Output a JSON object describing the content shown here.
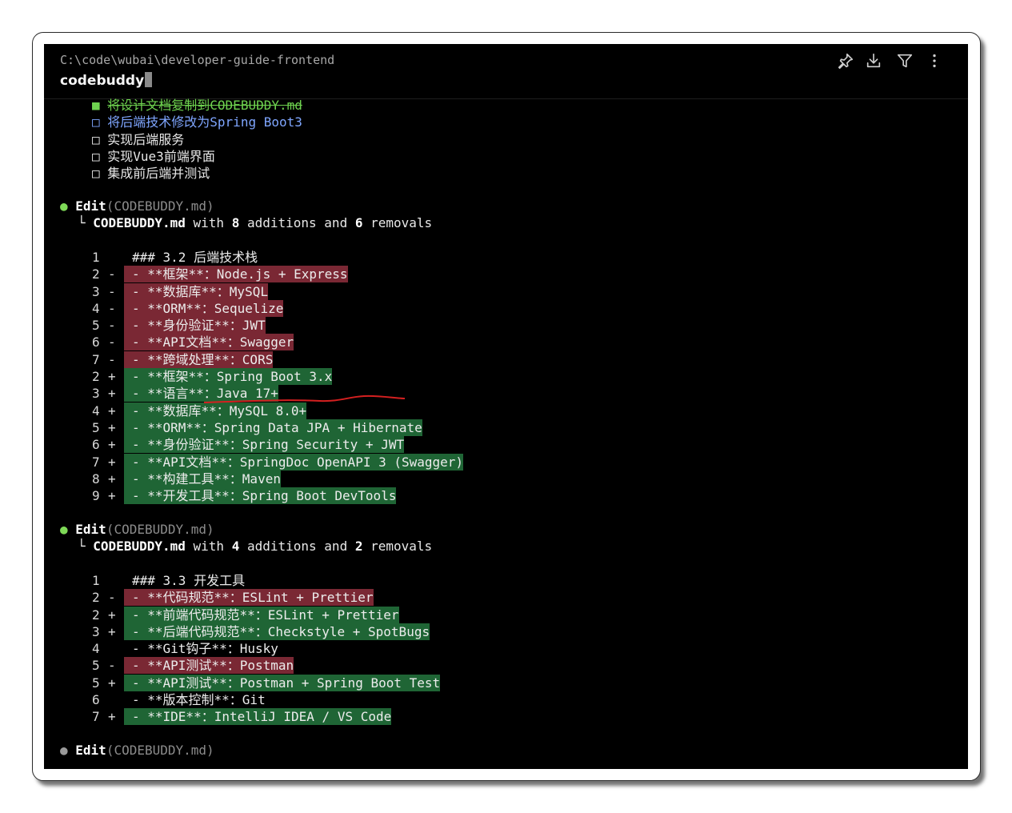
{
  "header": {
    "path": "C:\\code\\wubai\\developer-guide-frontend",
    "title": "codebuddy",
    "tools": [
      "pin-icon",
      "download-icon",
      "filter-icon",
      "more-vertical-icon"
    ]
  },
  "todos": [
    {
      "box": "■",
      "text": "将设计文档复制到CODEBUDDY.md",
      "state": "done"
    },
    {
      "box": "□",
      "text": "将后端技术修改为Spring Boot3",
      "state": "active"
    },
    {
      "box": "□",
      "text": "实现后端服务",
      "state": "pending"
    },
    {
      "box": "□",
      "text": "实现Vue3前端界面",
      "state": "pending"
    },
    {
      "box": "□",
      "text": "集成前后端并测试",
      "state": "pending"
    }
  ],
  "edits": [
    {
      "bullet": "●",
      "action": "Edit",
      "target": "(CODEBUDDY.md)",
      "summary": {
        "prefix": "└",
        "file": "CODEBUDDY.md",
        "w1": "with",
        "adds": "8",
        "w2": "additions and",
        "rems": "6",
        "w3": "removals"
      },
      "lines": [
        {
          "n": "1",
          "s": " ",
          "type": "ctx",
          "text": "### 3.2 后端技术栈"
        },
        {
          "n": "2",
          "s": "-",
          "type": "del",
          "text": "- **框架**：Node.js + Express"
        },
        {
          "n": "3",
          "s": "-",
          "type": "del",
          "text": "- **数据库**：MySQL"
        },
        {
          "n": "4",
          "s": "-",
          "type": "del",
          "text": "- **ORM**：Sequelize"
        },
        {
          "n": "5",
          "s": "-",
          "type": "del",
          "text": "- **身份验证**：JWT"
        },
        {
          "n": "6",
          "s": "-",
          "type": "del",
          "text": "- **API文档**：Swagger"
        },
        {
          "n": "7",
          "s": "-",
          "type": "del",
          "text": "- **跨域处理**：CORS"
        },
        {
          "n": "2",
          "s": "+",
          "type": "add",
          "text": "- **框架**：Spring Boot 3.x"
        },
        {
          "n": "3",
          "s": "+",
          "type": "add",
          "text": "- **语言**：Java 17+"
        },
        {
          "n": "4",
          "s": "+",
          "type": "add",
          "text": "- **数据库**：MySQL 8.0+"
        },
        {
          "n": "5",
          "s": "+",
          "type": "add",
          "text": "- **ORM**：Spring Data JPA + Hibernate"
        },
        {
          "n": "6",
          "s": "+",
          "type": "add",
          "text": "- **身份验证**：Spring Security + JWT"
        },
        {
          "n": "7",
          "s": "+",
          "type": "add",
          "text": "- **API文档**：SpringDoc OpenAPI 3 (Swagger)"
        },
        {
          "n": "8",
          "s": "+",
          "type": "add",
          "text": "- **构建工具**：Maven"
        },
        {
          "n": "9",
          "s": "+",
          "type": "add",
          "text": "- **开发工具**：Spring Boot DevTools"
        }
      ]
    },
    {
      "bullet": "●",
      "action": "Edit",
      "target": "(CODEBUDDY.md)",
      "summary": {
        "prefix": "└",
        "file": "CODEBUDDY.md",
        "w1": "with",
        "adds": "4",
        "w2": "additions and",
        "rems": "2",
        "w3": "removals"
      },
      "lines": [
        {
          "n": "1",
          "s": " ",
          "type": "ctx",
          "text": "### 3.3 开发工具"
        },
        {
          "n": "2",
          "s": "-",
          "type": "del",
          "text": "- **代码规范**：ESLint + Prettier"
        },
        {
          "n": "2",
          "s": "+",
          "type": "add",
          "text": "- **前端代码规范**：ESLint + Prettier"
        },
        {
          "n": "3",
          "s": "+",
          "type": "add",
          "text": "- **后端代码规范**：Checkstyle + SpotBugs"
        },
        {
          "n": "4",
          "s": " ",
          "type": "ctx",
          "text": "- **Git钩子**：Husky"
        },
        {
          "n": "5",
          "s": "-",
          "type": "del",
          "text": "- **API测试**：Postman"
        },
        {
          "n": "5",
          "s": "+",
          "type": "add",
          "text": "- **API测试**：Postman + Spring Boot Test"
        },
        {
          "n": "6",
          "s": " ",
          "type": "ctx",
          "text": "- **版本控制**：Git"
        },
        {
          "n": "7",
          "s": "+",
          "type": "add",
          "text": "- **IDE**：IntelliJ IDEA / VS Code"
        }
      ]
    }
  ],
  "pending_edit": {
    "bullet": "●",
    "action": "Edit",
    "target": "(CODEBUDDY.md)"
  },
  "colors": {
    "deleted": "#7a2834",
    "added": "#1f6535",
    "bullet_done": "#7ed957",
    "active_todo": "#7fa6ff"
  }
}
